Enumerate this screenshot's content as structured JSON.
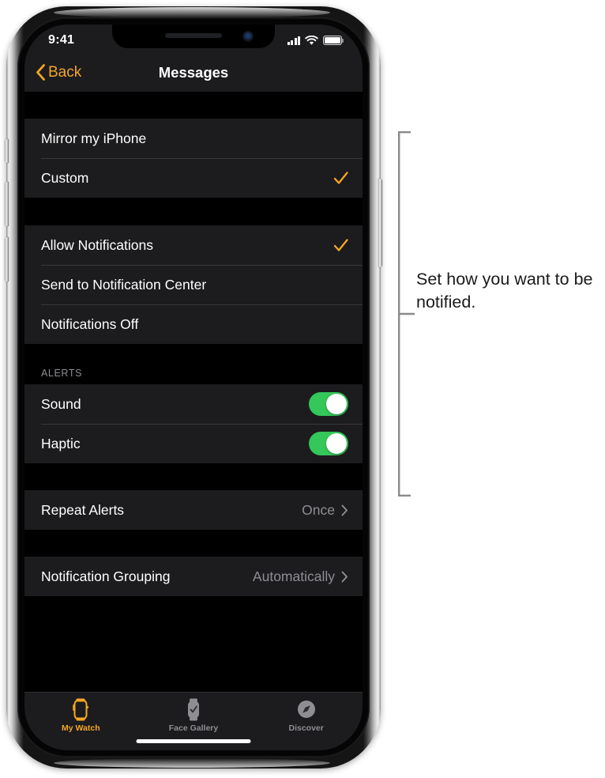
{
  "status_bar": {
    "time": "9:41",
    "signal_icon": "cellular-signal-icon",
    "wifi_icon": "wifi-icon",
    "battery_icon": "battery-full-icon"
  },
  "nav_bar": {
    "back_label": "Back",
    "back_icon": "chevron-left-icon",
    "title": "Messages"
  },
  "groups": [
    {
      "rows": [
        {
          "label": "Mirror my iPhone",
          "accessory": "none"
        },
        {
          "label": "Custom",
          "accessory": "checkmark"
        }
      ]
    },
    {
      "rows": [
        {
          "label": "Allow Notifications",
          "accessory": "checkmark"
        },
        {
          "label": "Send to Notification Center",
          "accessory": "none"
        },
        {
          "label": "Notifications Off",
          "accessory": "none"
        }
      ]
    }
  ],
  "alerts_section": {
    "header": "ALERTS",
    "rows": [
      {
        "label": "Sound",
        "toggle": "on"
      },
      {
        "label": "Haptic",
        "toggle": "on"
      }
    ]
  },
  "repeat_alerts": {
    "label": "Repeat Alerts",
    "value": "Once",
    "accessory": "chevron-right-icon"
  },
  "notification_grouping": {
    "label": "Notification Grouping",
    "value": "Automatically",
    "accessory": "chevron-right-icon"
  },
  "tab_bar": {
    "tabs": [
      {
        "label": "My Watch",
        "icon": "watch-icon",
        "active": true
      },
      {
        "label": "Face Gallery",
        "icon": "watch-face-icon",
        "active": false
      },
      {
        "label": "Discover",
        "icon": "compass-icon",
        "active": false
      }
    ]
  },
  "callout": {
    "text": "Set how you want to be notified."
  },
  "colors": {
    "accent_orange": "#f5a623",
    "toggle_green": "#34c759",
    "row_background": "#1c1c1e",
    "page_background": "#000000",
    "secondary_text": "#8e8e93",
    "callout_line": "#8a8a8a"
  }
}
